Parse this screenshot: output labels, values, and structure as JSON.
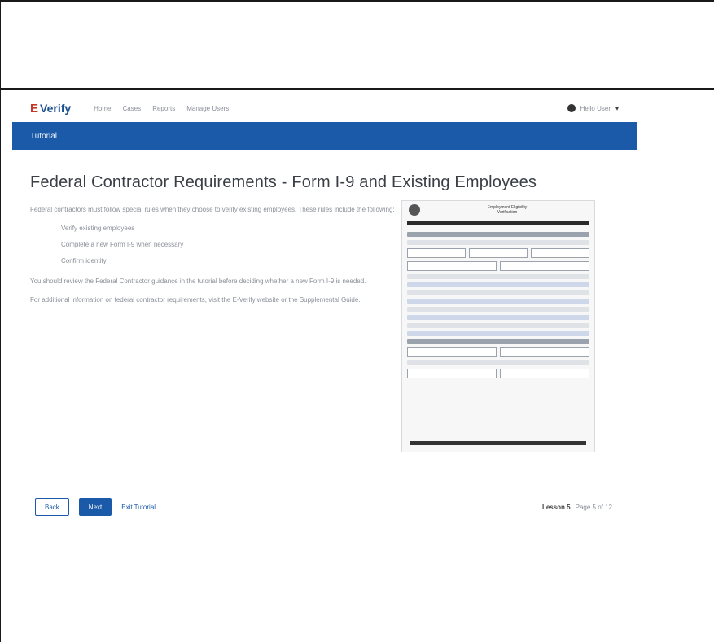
{
  "logo": {
    "mark": "E",
    "name": "Verify"
  },
  "nav": {
    "items": [
      "Home",
      "Cases",
      "Reports",
      "Manage Users"
    ]
  },
  "user": {
    "label": "Hello User"
  },
  "section": {
    "label": "Tutorial"
  },
  "page": {
    "title": "Federal Contractor Requirements - Form I-9 and Existing Employees"
  },
  "content": {
    "intro": "Federal contractors must follow special rules when they choose to verify existing employees. These rules include the following:",
    "bullets": [
      "Verify existing employees",
      "Complete a new Form I-9 when necessary",
      "Confirm identity"
    ],
    "para2": "You should review the Federal Contractor guidance in the tutorial before deciding whether a new Form I-9 is needed.",
    "para3": "For additional information on federal contractor requirements, visit the E-Verify website or the Supplemental Guide."
  },
  "form_image": {
    "title_line1": "Employment Eligibility",
    "title_line2": "Verification"
  },
  "footer": {
    "back_label": "Back",
    "next_label": "Next",
    "link_label": "Exit Tutorial",
    "pager_section": "Lesson 5",
    "pager_page": "Page 5 of 12"
  },
  "colors": {
    "brand_blue": "#1a5aa8",
    "logo_red": "#c0392b"
  }
}
